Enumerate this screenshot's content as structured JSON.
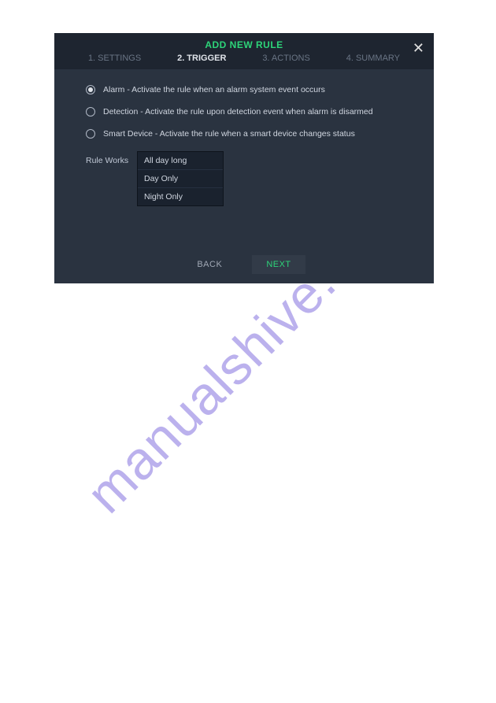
{
  "watermark": "manualshive.com",
  "dialog": {
    "title": "ADD NEW RULE",
    "tabs": [
      {
        "label": "1. SETTINGS",
        "active": false
      },
      {
        "label": "2. TRIGGER",
        "active": true
      },
      {
        "label": "3. ACTIONS",
        "active": false
      },
      {
        "label": "4. SUMMARY",
        "active": false
      }
    ],
    "options": [
      {
        "label": "Alarm - Activate the rule when an alarm system event occurs",
        "selected": true
      },
      {
        "label": "Detection - Activate the rule upon detection event when alarm is disarmed",
        "selected": false
      },
      {
        "label": "Smart Device - Activate the rule when a smart device changes status",
        "selected": false
      }
    ],
    "rule_works_label": "Rule Works",
    "dropdown": [
      "All day long",
      "Day Only",
      "Night Only"
    ],
    "buttons": {
      "back": "BACK",
      "next": "NEXT"
    }
  }
}
